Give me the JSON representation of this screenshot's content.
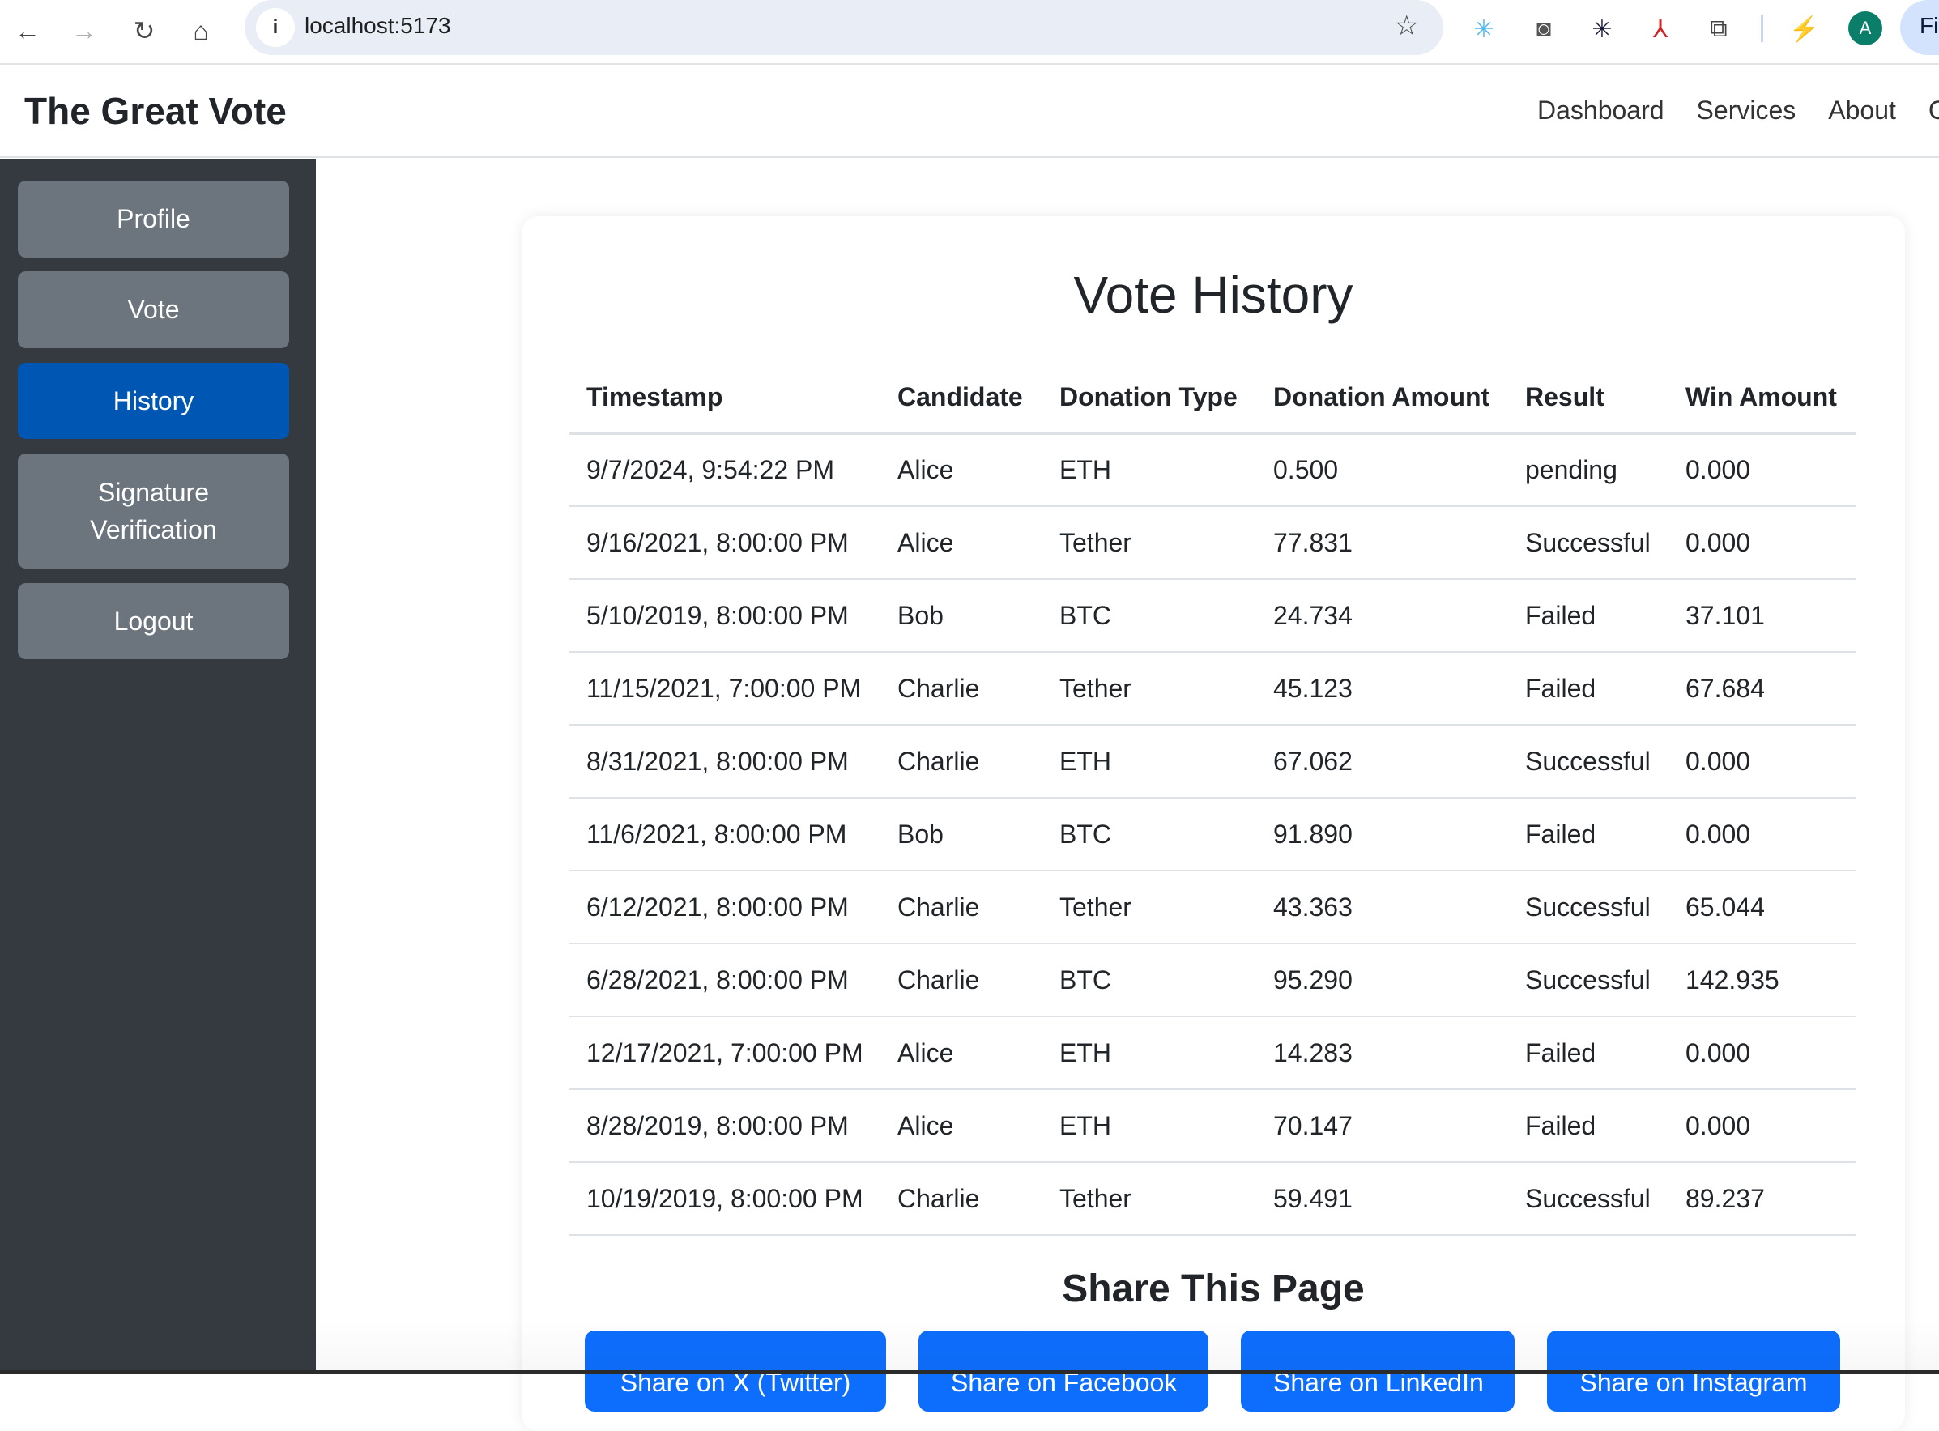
{
  "browser": {
    "url": "localhost:5173",
    "avatar_letter": "A",
    "profile_chip": "Fi",
    "icons": {
      "back": "←",
      "forward": "→",
      "reload": "↻",
      "home": "⌂",
      "info": "i",
      "star": "☆"
    },
    "extensions": [
      {
        "name": "perplexity-extension-icon",
        "glyph": "✳",
        "color": "#4db6f0"
      },
      {
        "name": "screen-recorder-extension-icon",
        "glyph": "◙",
        "color": "#555555"
      },
      {
        "name": "asterisk-extension-icon",
        "glyph": "✳",
        "color": "#1a1a3a"
      },
      {
        "name": "acrobat-extension-icon",
        "glyph": "⅄",
        "color": "#d32020"
      },
      {
        "name": "puzzle-extensions-icon",
        "glyph": "⧉",
        "color": "#444444"
      },
      {
        "name": "energy-saver-icon",
        "glyph": "⚡",
        "color": "#444444"
      }
    ]
  },
  "header": {
    "brand": "The Great Vote",
    "nav": [
      "Dashboard",
      "Services",
      "About",
      "C"
    ]
  },
  "sidebar": {
    "items": [
      {
        "label": "Profile",
        "active": false
      },
      {
        "label": "Vote",
        "active": false
      },
      {
        "label": "History",
        "active": true
      },
      {
        "label": "Signature Verification",
        "active": false
      },
      {
        "label": "Logout",
        "active": false
      }
    ]
  },
  "main": {
    "title": "Vote History",
    "columns": [
      "Timestamp",
      "Candidate",
      "Donation Type",
      "Donation Amount",
      "Result",
      "Win Amount"
    ],
    "rows": [
      [
        "9/7/2024, 9:54:22 PM",
        "Alice",
        "ETH",
        "0.500",
        "pending",
        "0.000"
      ],
      [
        "9/16/2021, 8:00:00 PM",
        "Alice",
        "Tether",
        "77.831",
        "Successful",
        "0.000"
      ],
      [
        "5/10/2019, 8:00:00 PM",
        "Bob",
        "BTC",
        "24.734",
        "Failed",
        "37.101"
      ],
      [
        "11/15/2021, 7:00:00 PM",
        "Charlie",
        "Tether",
        "45.123",
        "Failed",
        "67.684"
      ],
      [
        "8/31/2021, 8:00:00 PM",
        "Charlie",
        "ETH",
        "67.062",
        "Successful",
        "0.000"
      ],
      [
        "11/6/2021, 8:00:00 PM",
        "Bob",
        "BTC",
        "91.890",
        "Failed",
        "0.000"
      ],
      [
        "6/12/2021, 8:00:00 PM",
        "Charlie",
        "Tether",
        "43.363",
        "Successful",
        "65.044"
      ],
      [
        "6/28/2021, 8:00:00 PM",
        "Charlie",
        "BTC",
        "95.290",
        "Successful",
        "142.935"
      ],
      [
        "12/17/2021, 7:00:00 PM",
        "Alice",
        "ETH",
        "14.283",
        "Failed",
        "0.000"
      ],
      [
        "8/28/2019, 8:00:00 PM",
        "Alice",
        "ETH",
        "70.147",
        "Failed",
        "0.000"
      ],
      [
        "10/19/2019, 8:00:00 PM",
        "Charlie",
        "Tether",
        "59.491",
        "Successful",
        "89.237"
      ]
    ],
    "share": {
      "title": "Share This Page",
      "buttons": [
        "Share on X (Twitter)",
        "Share on Facebook",
        "Share on LinkedIn",
        "Share on Instagram"
      ]
    }
  },
  "colors": {
    "sidebar_bg": "#343a40",
    "sidebar_button": "#6c757d",
    "sidebar_active": "#0056b3",
    "share_button": "#0d6efd"
  }
}
